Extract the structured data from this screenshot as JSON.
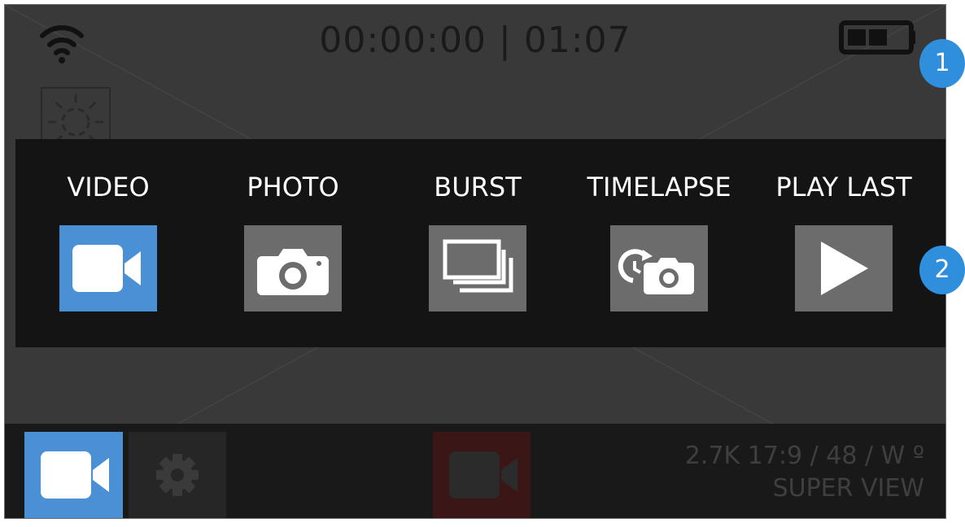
{
  "status": {
    "elapsed": "00:00:00",
    "separator": "|",
    "remaining": "01:07",
    "wifi_icon": "wifi-icon",
    "battery_icon": "battery-icon",
    "battery_level": 0.66
  },
  "modes": [
    {
      "label": "VIDEO",
      "icon": "video-camera-icon",
      "active": true
    },
    {
      "label": "PHOTO",
      "icon": "photo-camera-icon",
      "active": false
    },
    {
      "label": "BURST",
      "icon": "burst-stack-icon",
      "active": false
    },
    {
      "label": "TIMELAPSE",
      "icon": "timelapse-camera-icon",
      "active": false
    },
    {
      "label": "PLAY LAST",
      "icon": "play-icon",
      "active": false
    }
  ],
  "bottom": {
    "settings_line1": "2.7K 17:9 / 48 / W º",
    "settings_line2": "SUPER VIEW"
  },
  "callouts": [
    "1",
    "2"
  ],
  "colors": {
    "accent": "#4a90d4",
    "callout": "#2f8fdd",
    "record_dim": "#3a1616",
    "screen_bg": "#393939",
    "overlay_bg": "#141414"
  }
}
